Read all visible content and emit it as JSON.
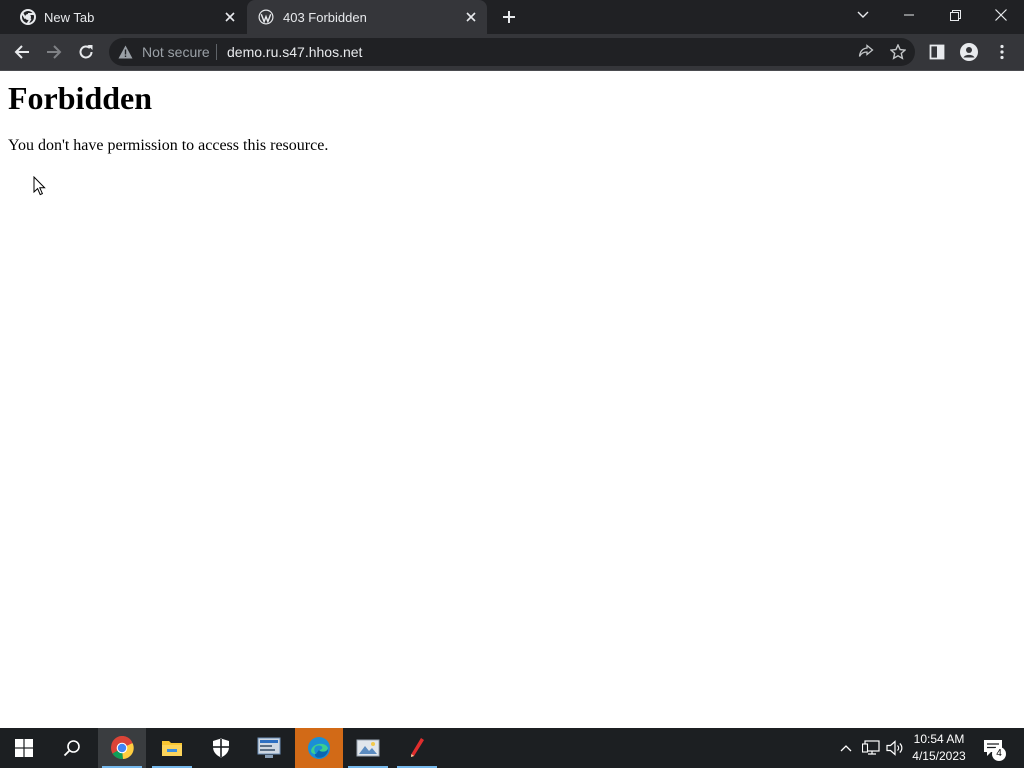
{
  "browser": {
    "tabs": [
      {
        "title": "New Tab",
        "icon": "chrome-icon",
        "active": false
      },
      {
        "title": "403 Forbidden",
        "icon": "wordpress-icon",
        "active": true
      }
    ],
    "toolbar": {
      "security_label": "Not secure",
      "url": "demo.ru.s47.hhos.net"
    }
  },
  "page": {
    "heading": "Forbidden",
    "message": "You don't have permission to access this resource."
  },
  "taskbar": {
    "pinned": [
      "windows-start-icon",
      "search-icon",
      "chrome-icon",
      "file-explorer-icon",
      "security-shield-icon",
      "server-manager-icon",
      "edge-icon",
      "image-viewer-icon",
      "pen-app-icon"
    ],
    "clock": {
      "time": "10:54 AM",
      "date": "4/15/2023"
    },
    "notification_count": "4"
  },
  "colors": {
    "tab_strip": "#202124",
    "toolbar": "#35363a",
    "omnibox": "#202124",
    "taskbar": "#1c1f22",
    "edge_highlight": "#d26a17"
  }
}
